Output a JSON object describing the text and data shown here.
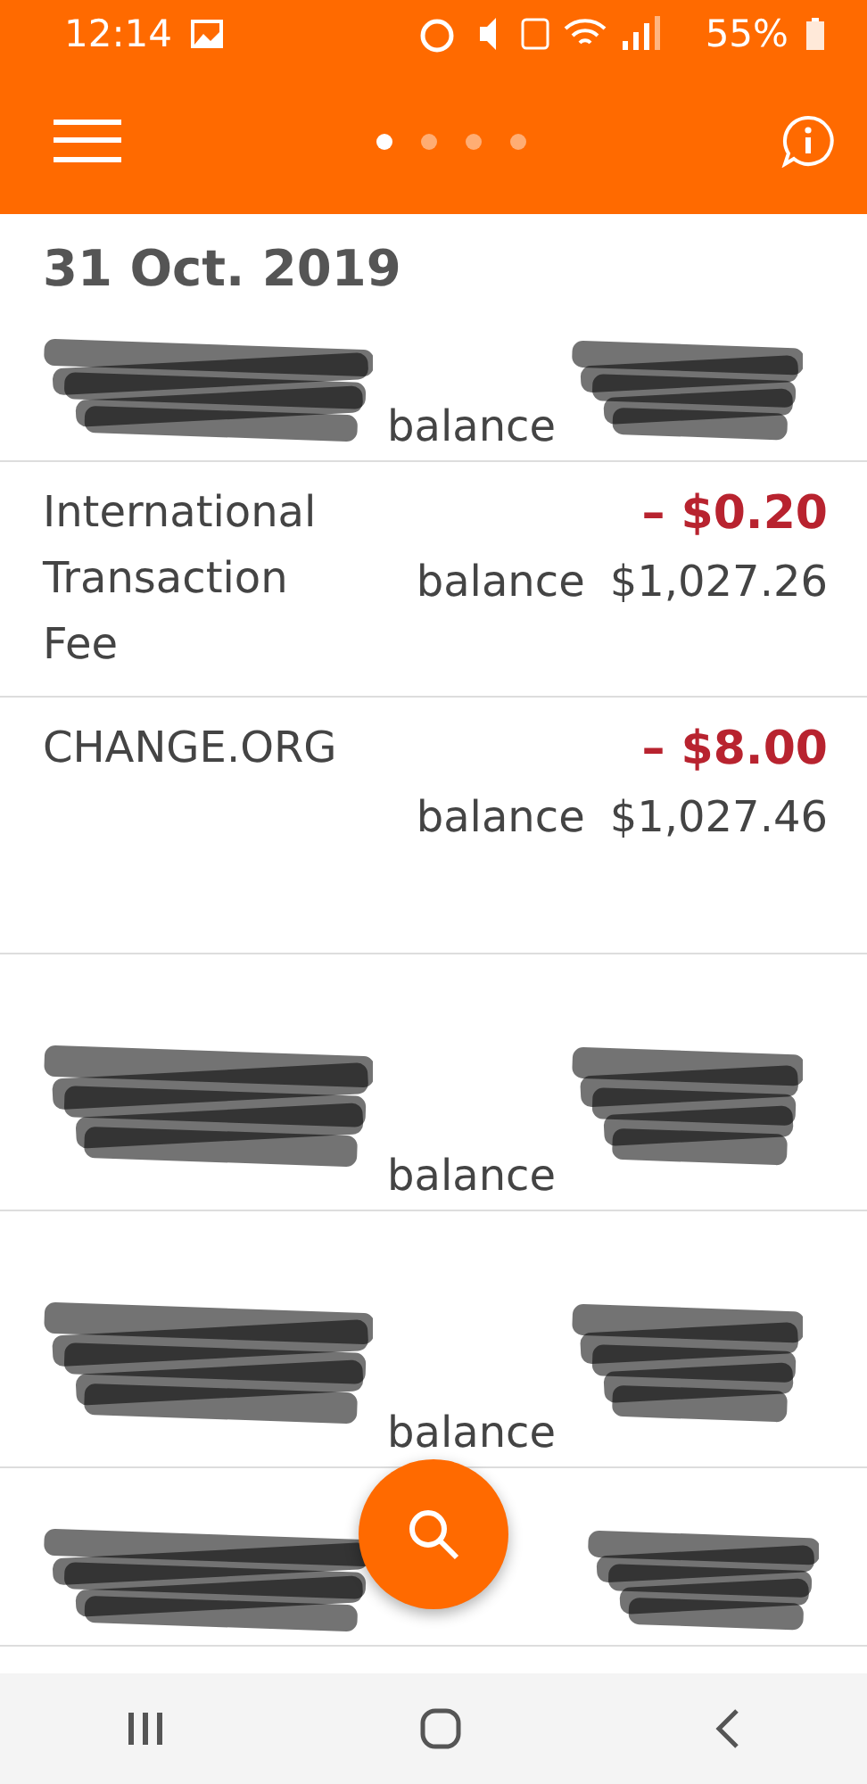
{
  "status_bar": {
    "time": "12:14",
    "battery": "55%"
  },
  "header": {
    "pages": [
      {
        "selected": true
      },
      {
        "selected": false
      },
      {
        "selected": false
      },
      {
        "selected": false
      }
    ]
  },
  "date_heading": "31 Oct. 2019",
  "transactions": [
    {
      "kind": "redacted",
      "balance_label": "balance"
    },
    {
      "kind": "plain",
      "name": "International Transaction Fee",
      "amount": "– $0.20",
      "balance_label": "balance",
      "balance": "$1,027.26"
    },
    {
      "kind": "plain",
      "name": "CHANGE.ORG",
      "amount": "– $8.00",
      "balance_label": "balance",
      "balance": "$1,027.46"
    },
    {
      "kind": "redacted",
      "balance_label": "balance"
    },
    {
      "kind": "redacted",
      "balance_label": "balance"
    },
    {
      "kind": "redacted_cut"
    }
  ]
}
